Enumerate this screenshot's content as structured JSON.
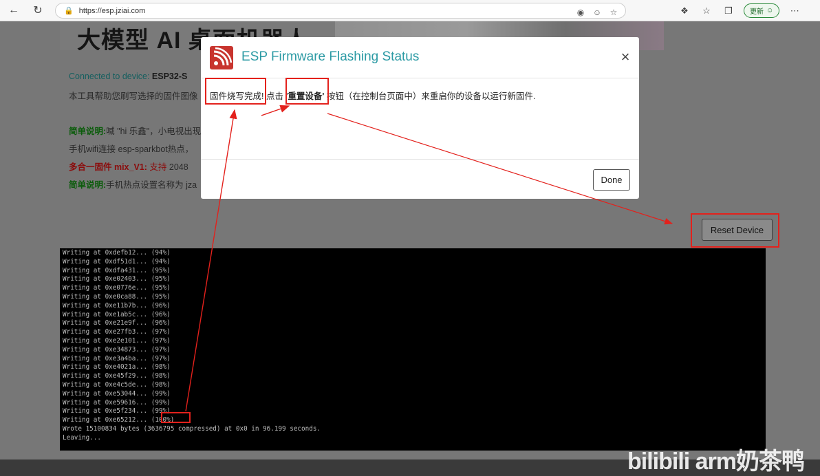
{
  "browser": {
    "url": "https://esp.jziai.com",
    "update_label": "更新"
  },
  "page": {
    "banner_title": "大模型 AI 桌面机器人",
    "connected_label": "Connected to device: ",
    "connected_value": "ESP32-S",
    "intro": "本工具帮助您刷写选择的固件图像",
    "note1_label": "简单说明:",
    "note1_text": "喊 \"hi 乐鑫\"，小电视出现",
    "note1_line2": "手机wifi连接 esp-sparkbot热点，",
    "mix_label": "多合一固件 mix_V1:",
    "mix_support": "支持",
    "mix_text": " 2048",
    "note2_label": "简单说明:",
    "note2_text": "手机热点设置名称为 jza"
  },
  "reset_button": "Reset Device",
  "terminal_lines": [
    "Writing at 0xdefb12... (94%)",
    "Writing at 0xdf51d1... (94%)",
    "Writing at 0xdfa431... (95%)",
    "Writing at 0xe02403... (95%)",
    "Writing at 0xe0776e... (95%)",
    "Writing at 0xe0ca88... (95%)",
    "Writing at 0xe11b7b... (96%)",
    "Writing at 0xe1ab5c... (96%)",
    "Writing at 0xe21e9f... (96%)",
    "Writing at 0xe27fb3... (97%)",
    "Writing at 0xe2e101... (97%)",
    "Writing at 0xe34873... (97%)",
    "Writing at 0xe3a4ba... (97%)",
    "Writing at 0xe4021a... (98%)",
    "Writing at 0xe45f29... (98%)",
    "Writing at 0xe4c5de... (98%)",
    "Writing at 0xe53044... (99%)",
    "Writing at 0xe59616... (99%)",
    "Writing at 0xe5f234... (99%)",
    "Writing at 0xe65212... (100%)",
    "Wrote 15100834 bytes (3636795 compressed) at 0x0 in 96.199 seconds.",
    "Leaving..."
  ],
  "modal": {
    "title": "ESP Firmware Flashing Status",
    "msg_part1": "固件烧写完成!",
    "msg_part2": " 点击 ",
    "msg_bold": "'重置设备'",
    "msg_part3": " 按钮（在控制台页面中）来重启你的设备以运行新固件.",
    "done_label": "Done"
  },
  "watermark": "bilibili arm奶茶鸭",
  "colors": {
    "annotation_red": "#e3211c",
    "title_teal": "#2b9aa4",
    "logo_red": "#c8342e"
  }
}
